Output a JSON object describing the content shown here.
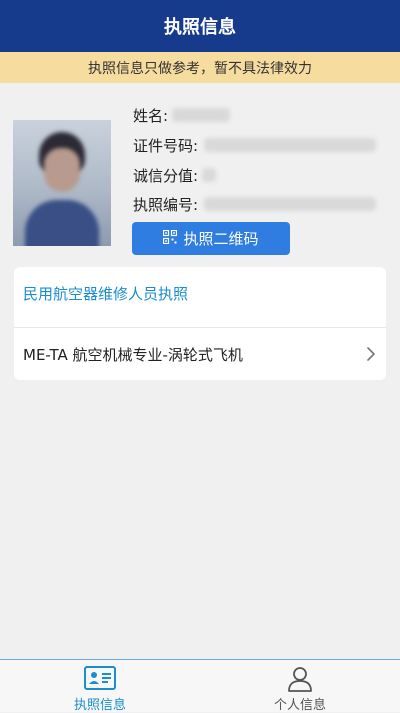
{
  "header": {
    "title": "执照信息"
  },
  "notice": {
    "text": "执照信息只做参考，暂不具法律效力"
  },
  "profile": {
    "name_label": "姓名:",
    "id_label": "证件号码:",
    "credit_label": "诚信分值:",
    "license_no_label": "执照编号:",
    "qr_button_label": "执照二维码"
  },
  "license_card": {
    "title": "民用航空器维修人员执照",
    "items": [
      {
        "label": "ME-TA 航空机械专业-涡轮式飞机"
      }
    ]
  },
  "tabbar": {
    "tabs": [
      {
        "label": "执照信息",
        "active": true
      },
      {
        "label": "个人信息",
        "active": false
      }
    ]
  },
  "colors": {
    "header_bg": "#163a8c",
    "notice_bg": "#f6dc9e",
    "button_bg": "#2f7de1",
    "accent": "#1a8dcf",
    "inactive": "#555555"
  }
}
